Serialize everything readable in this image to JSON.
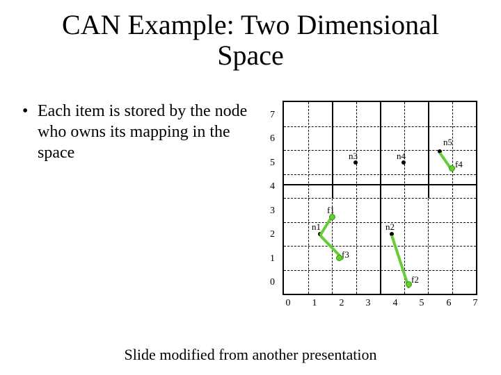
{
  "title": "CAN Example: Two Dimensional Space",
  "bullet": "Each item is stored by the node who owns its mapping in the space",
  "footer": "Slide modified from another presentation",
  "chart_data": {
    "type": "scatter",
    "xlabel": "",
    "ylabel": "",
    "xlim": [
      0,
      7
    ],
    "ylim": [
      0,
      7
    ],
    "x_ticks": [
      "0",
      "1",
      "2",
      "3",
      "4",
      "5",
      "6",
      "7"
    ],
    "y_ticks": [
      "0",
      "1",
      "2",
      "3",
      "4",
      "5",
      "6",
      "7"
    ],
    "series": [
      {
        "name": "nodes",
        "points": [
          {
            "id": "n1",
            "x": 1.5,
            "y": 2.5
          },
          {
            "id": "n2",
            "x": 4.5,
            "y": 2.5
          },
          {
            "id": "n3",
            "x": 3.0,
            "y": 5.5
          },
          {
            "id": "n4",
            "x": 5.0,
            "y": 5.5
          },
          {
            "id": "n5",
            "x": 6.5,
            "y": 6.0
          }
        ]
      },
      {
        "name": "items",
        "points": [
          {
            "id": "f1",
            "x": 2.0,
            "y": 3.2
          },
          {
            "id": "f2",
            "x": 5.2,
            "y": 0.5
          },
          {
            "id": "f3",
            "x": 2.3,
            "y": 1.5
          },
          {
            "id": "f4",
            "x": 7.0,
            "y": 5.3
          }
        ]
      }
    ],
    "links": [
      {
        "from": "n1",
        "to": "f1"
      },
      {
        "from": "n1",
        "to": "f3"
      },
      {
        "from": "n2",
        "to": "f2"
      },
      {
        "from": "n5",
        "to": "f4"
      }
    ],
    "partitions": {
      "h_solid": [
        4
      ],
      "v_solid": [
        {
          "x": 4,
          "y0": 0,
          "y1": 7
        },
        {
          "x": 2,
          "y0": 4,
          "y1": 7
        },
        {
          "x": 6,
          "y0": 4,
          "y1": 7
        }
      ]
    }
  },
  "labels": {
    "n1": "n1",
    "n2": "n2",
    "n3": "n3",
    "n4": "n4",
    "n5": "n5",
    "f1": "f1",
    "f2": "f2",
    "f3": "f3",
    "f4": "f4"
  }
}
